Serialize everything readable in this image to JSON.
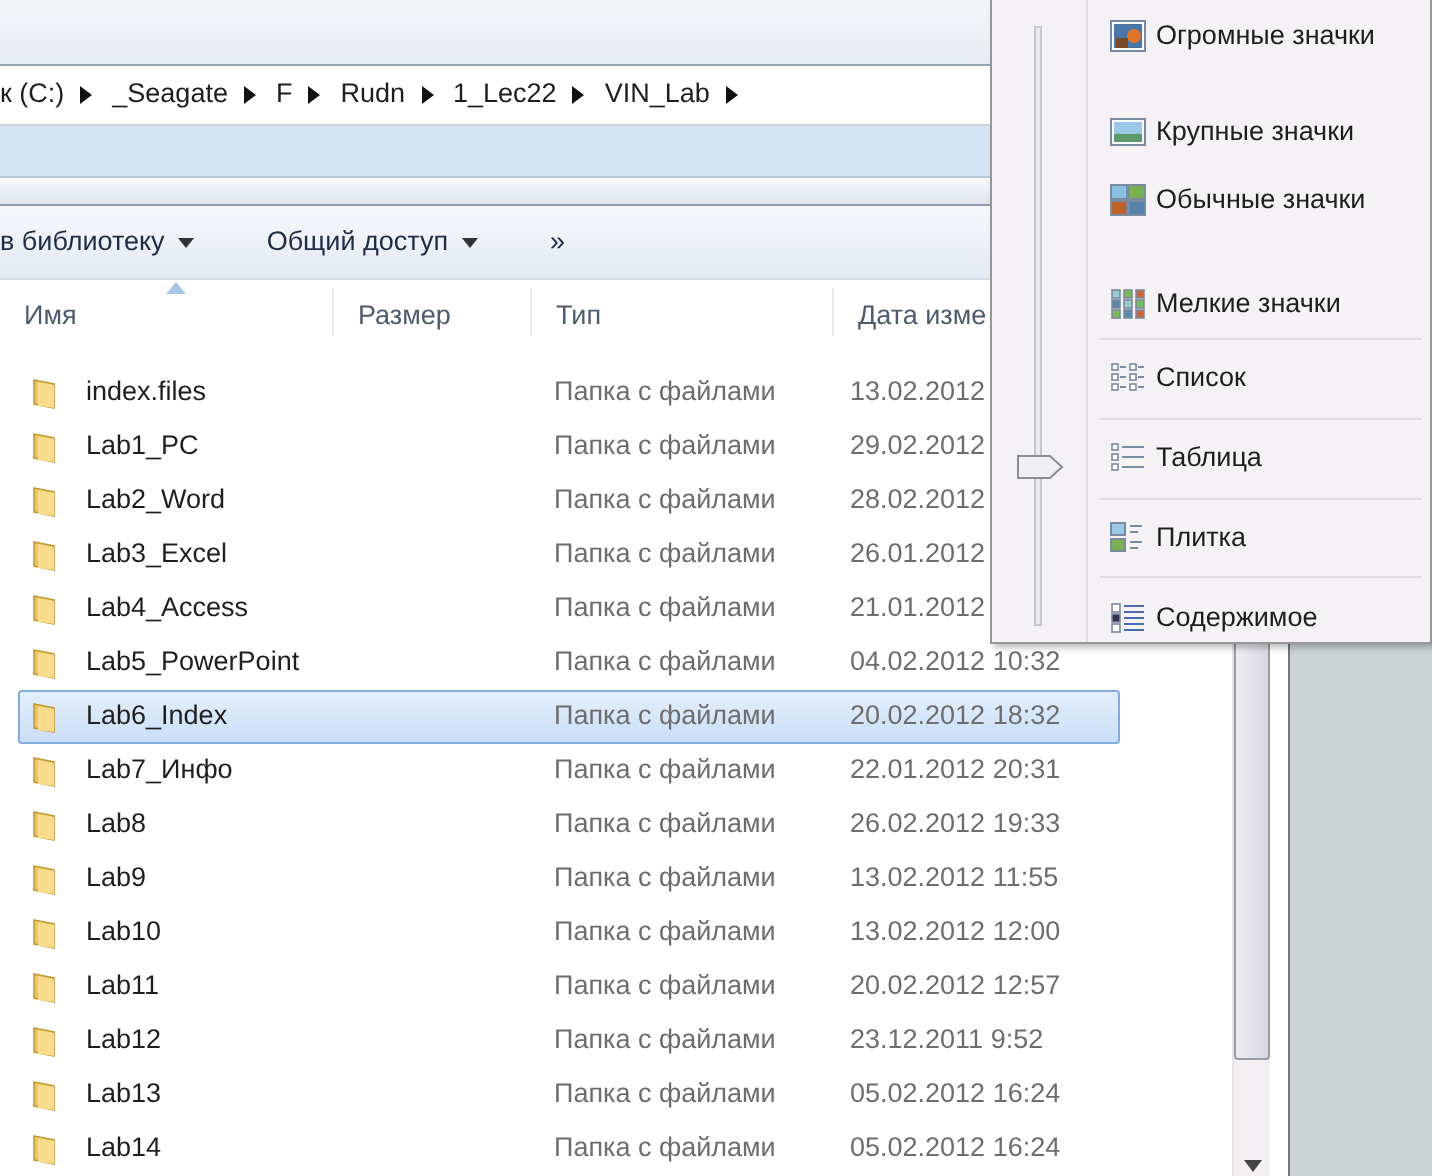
{
  "breadcrumb": [
    "к (C:)",
    "_Seagate",
    "F",
    "Rudn",
    "1_Lec22",
    "VIN_Lab"
  ],
  "toolbar": [
    {
      "label": "в библиотеку",
      "kind": "dropdown"
    },
    {
      "label": "Общий доступ",
      "kind": "dropdown"
    },
    {
      "label": "»",
      "kind": "more"
    }
  ],
  "columns": [
    {
      "label": "Имя",
      "sorted": true
    },
    {
      "label": "Размер",
      "sorted": false
    },
    {
      "label": "Тип",
      "sorted": false
    },
    {
      "label": "Дата изме",
      "sorted": false
    }
  ],
  "rows": [
    {
      "name": "index.files",
      "type": "Папка с файлами",
      "date": "13.02.2012",
      "selected": false
    },
    {
      "name": "Lab1_PC",
      "type": "Папка с файлами",
      "date": "29.02.2012",
      "selected": false
    },
    {
      "name": "Lab2_Word",
      "type": "Папка с файлами",
      "date": "28.02.2012",
      "selected": false
    },
    {
      "name": "Lab3_Excel",
      "type": "Папка с файлами",
      "date": "26.01.2012",
      "selected": false
    },
    {
      "name": "Lab4_Access",
      "type": "Папка с файлами",
      "date": "21.01.2012",
      "selected": false
    },
    {
      "name": "Lab5_PowerPoint",
      "type": "Папка с файлами",
      "date": "04.02.2012 10:32",
      "selected": false
    },
    {
      "name": "Lab6_Index",
      "type": "Папка с файлами",
      "date": "20.02.2012 18:32",
      "selected": true
    },
    {
      "name": "Lab7_Инфо",
      "type": "Папка с файлами",
      "date": "22.01.2012 20:31",
      "selected": false
    },
    {
      "name": "Lab8",
      "type": "Папка с файлами",
      "date": "26.02.2012 19:33",
      "selected": false
    },
    {
      "name": "Lab9",
      "type": "Папка с файлами",
      "date": "13.02.2012 11:55",
      "selected": false
    },
    {
      "name": "Lab10",
      "type": "Папка с файлами",
      "date": "13.02.2012 12:00",
      "selected": false
    },
    {
      "name": "Lab11",
      "type": "Папка с файлами",
      "date": "20.02.2012 12:57",
      "selected": false
    },
    {
      "name": "Lab12",
      "type": "Папка с файлами",
      "date": "23.12.2011 9:52",
      "selected": false
    },
    {
      "name": "Lab13",
      "type": "Папка с файлами",
      "date": "05.02.2012 16:24",
      "selected": false
    },
    {
      "name": "Lab14",
      "type": "Папка с файлами",
      "date": "05.02.2012 16:24",
      "selected": false
    }
  ],
  "view_menu": {
    "level": 0.27,
    "items": [
      {
        "label": "Огромные значки",
        "kind": "huge"
      },
      {
        "label": "Крупные значки",
        "kind": "large"
      },
      {
        "label": "Обычные значки",
        "kind": "medium"
      },
      {
        "label": "Мелкие значки",
        "kind": "small"
      },
      {
        "label": "Список",
        "kind": "list"
      },
      {
        "label": "Таблица",
        "kind": "details"
      },
      {
        "label": "Плитка",
        "kind": "tiles"
      },
      {
        "label": "Содержимое",
        "kind": "content"
      }
    ]
  }
}
